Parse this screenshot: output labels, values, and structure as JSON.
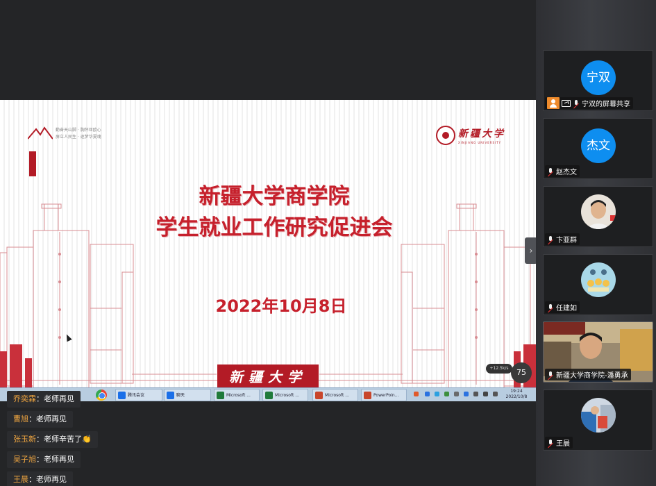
{
  "slide": {
    "motto_line1": "勤奋天山脚 · 胸怀亚欧心",
    "motto_line2": "屏立人民生 · 逐梦华夏魂",
    "university_name": "新疆大学",
    "university_sub": "XINJIANG UNIVERSITY",
    "title_line1": "新疆大学商学院",
    "title_line2": "学生就业工作研究促进会",
    "date": "2022年10月8日",
    "seal_text": "新疆大学"
  },
  "overlay": {
    "zoom": "75",
    "network": "+12.5k/s"
  },
  "taskbar": {
    "items": [
      {
        "label": "腾讯会议",
        "color": "#1a6fe8"
      },
      {
        "label": "聊天",
        "color": "#1a6fe8"
      },
      {
        "label": "Microsoft ...",
        "color": "#1f7a3a"
      },
      {
        "label": "Microsoft ...",
        "color": "#1f7a3a"
      },
      {
        "label": "Microsoft ...",
        "color": "#c8462b"
      },
      {
        "label": "PowerPoin...",
        "color": "#c8462b"
      }
    ],
    "time": "19:24",
    "date": "2022/10/8"
  },
  "chat": [
    {
      "name": "乔奕霖",
      "text": "老师再见"
    },
    {
      "name": "曹旭",
      "text": "老师再见"
    },
    {
      "name": "张玉新",
      "text": "老师辛苦了👏"
    },
    {
      "name": "吴子旭",
      "text": "老师再见"
    },
    {
      "name": "王晨",
      "text": "老师再见"
    }
  ],
  "participants": [
    {
      "avatar": "宁双",
      "name": "宁双的屏幕共享",
      "type": "share"
    },
    {
      "avatar": "杰文",
      "name": "赵杰文",
      "type": "avatar"
    },
    {
      "name": "卞亚群",
      "type": "photo"
    },
    {
      "name": "任建如",
      "type": "photo"
    },
    {
      "name": "新疆大学商学院-潘勇承",
      "type": "video"
    },
    {
      "name": "王晨",
      "type": "photo"
    }
  ],
  "colors": {
    "accent_blue": "#0e8ef0",
    "slide_red": "#c6202c",
    "chat_name": "#f0a640"
  }
}
